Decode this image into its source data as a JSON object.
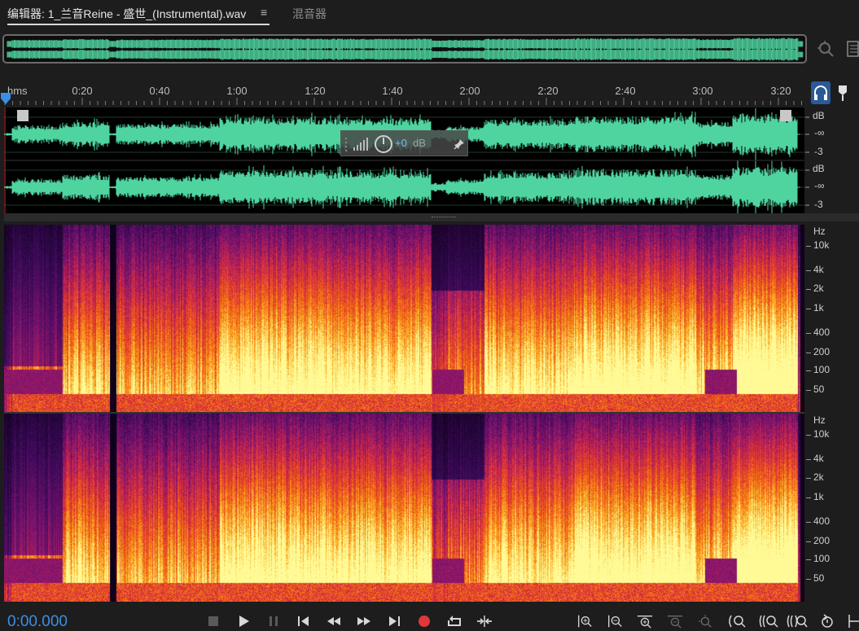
{
  "tabs": {
    "editor_label": "编辑器: 1_兰音Reine - 盛世_(Instrumental).wav",
    "menu_glyph": "≡",
    "mixer_label": "混音器"
  },
  "ruler": {
    "unit_label": "hms",
    "ticks": [
      "0:20",
      "0:40",
      "1:00",
      "1:20",
      "1:40",
      "2:00",
      "2:20",
      "2:40",
      "3:00",
      "3:20"
    ]
  },
  "waveform": {
    "color": "#4fd4a0",
    "channels": [
      {
        "scale_unit": "dB",
        "scale_mid": "-∞",
        "scale_low": "-3"
      },
      {
        "scale_unit": "dB",
        "scale_mid": "-∞",
        "scale_low": "-3"
      }
    ]
  },
  "hud": {
    "volume_value": "+0",
    "volume_unit": "dB"
  },
  "spectral": {
    "unit": "Hz",
    "labels": [
      "10k",
      "4k",
      "2k",
      "1k",
      "400",
      "200",
      "100",
      "50"
    ]
  },
  "transport": {
    "timecode": "0:00.000",
    "record_color": "#e0383a"
  },
  "icons": [
    "zoom-icon",
    "panel-icon",
    "headphones-icon",
    "marker-icon",
    "stop-icon",
    "play-icon",
    "pause-icon",
    "goto-start-icon",
    "rewind-icon",
    "fast-forward-icon",
    "goto-end-icon",
    "record-icon",
    "loop-icon",
    "skip-selection-icon",
    "zoom-in-amplitude-icon",
    "zoom-out-amplitude-icon",
    "zoom-in-time-icon",
    "zoom-out-time-icon",
    "zoom-full-icon",
    "zoom-selection-icon"
  ]
}
